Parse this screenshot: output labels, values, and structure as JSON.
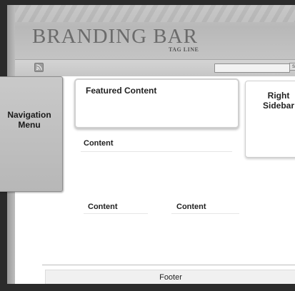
{
  "branding": {
    "title": "BRANDING BAR",
    "tagline": "TAG LINE"
  },
  "toolbar": {
    "feed_icon": "rss-feed-icon",
    "search_placeholder": "",
    "search_button_label": "Search"
  },
  "navigation": {
    "label_line1": "Navigation",
    "label_line2": "Menu"
  },
  "main": {
    "featured_label": "Featured Content",
    "content_blocks": [
      "Content",
      "Content",
      "Content"
    ]
  },
  "sidebar": {
    "label_line1": "Right",
    "label_line2": "Sidebar"
  },
  "footer": {
    "label": "Footer"
  },
  "colors": {
    "header_bg": "#c0c0c0",
    "page_bg": "#ffffff",
    "frame_dark": "#2b2b2b"
  }
}
